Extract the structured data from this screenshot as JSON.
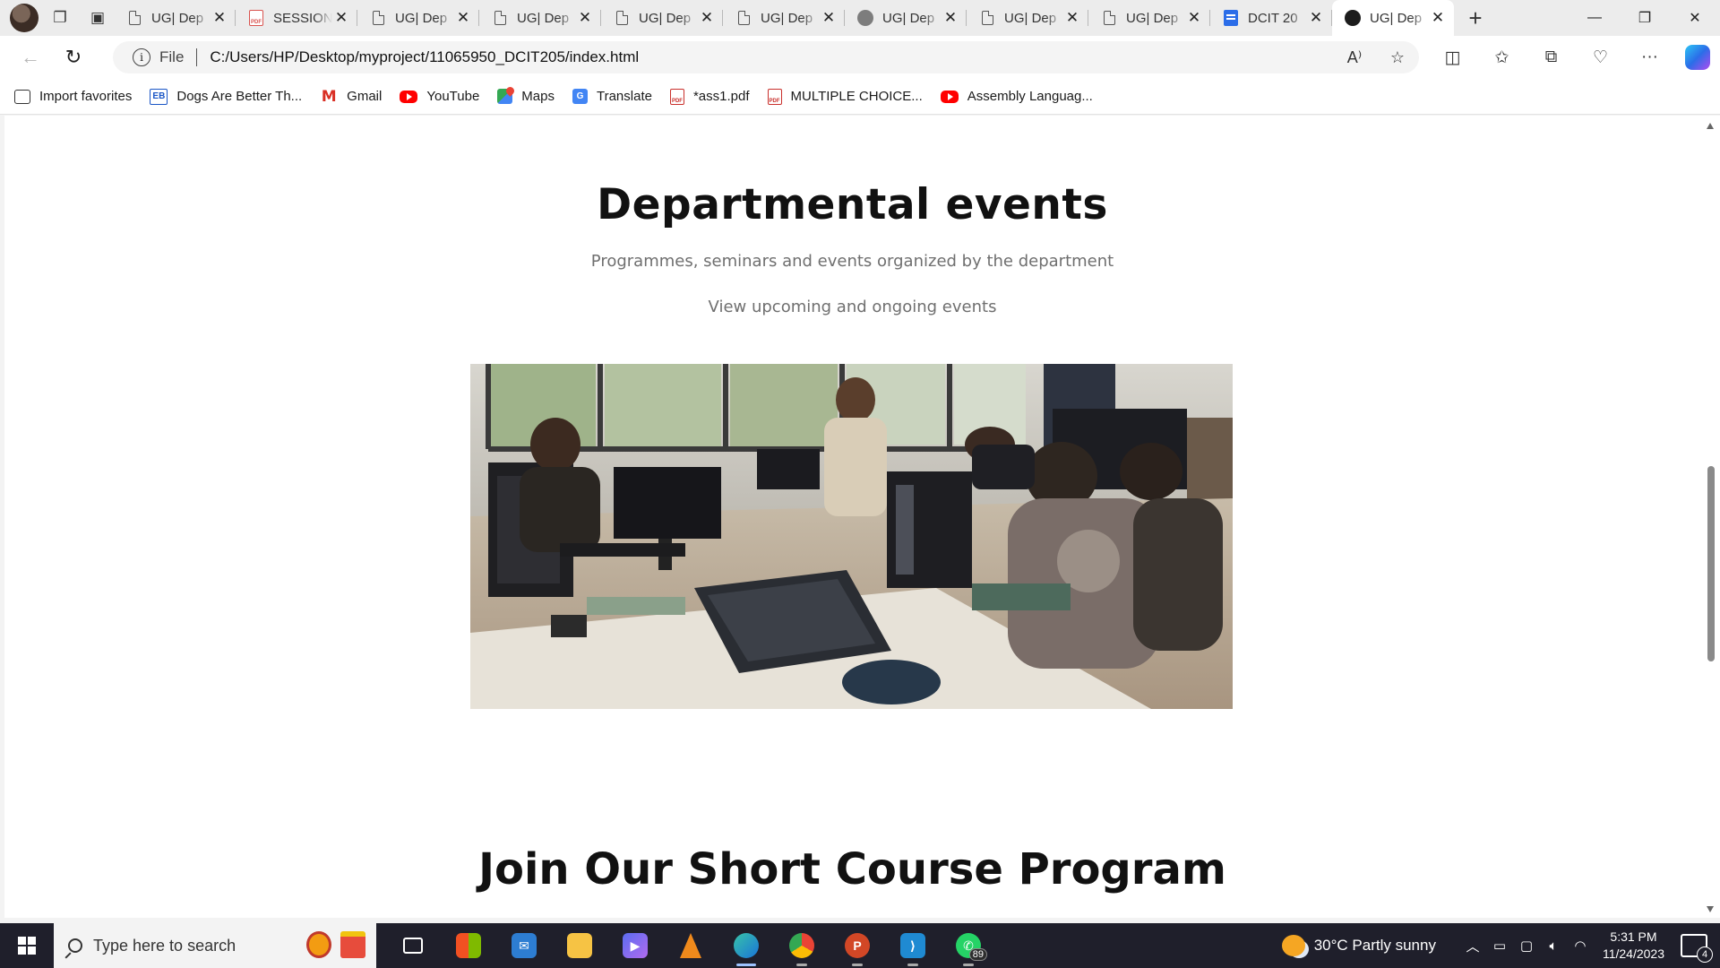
{
  "browser": {
    "tabs": [
      {
        "title": "UG| Dep",
        "icon": "page-icon",
        "active": false
      },
      {
        "title": "SESSION",
        "icon": "pdf-icon",
        "active": false
      },
      {
        "title": "UG| Dep",
        "icon": "page-icon",
        "active": false
      },
      {
        "title": "UG| Dep",
        "icon": "page-icon",
        "active": false
      },
      {
        "title": "UG| Dep",
        "icon": "page-icon",
        "active": false
      },
      {
        "title": "UG| Dep",
        "icon": "page-icon",
        "active": false
      },
      {
        "title": "UG| Dep",
        "icon": "logo-grey-icon",
        "active": false
      },
      {
        "title": "UG| Dep",
        "icon": "page-icon",
        "active": false
      },
      {
        "title": "UG| Dep",
        "icon": "page-icon",
        "active": false
      },
      {
        "title": "DCIT 20",
        "icon": "doc-icon",
        "active": false
      },
      {
        "title": "UG| Dep",
        "icon": "logo-icon",
        "active": true
      }
    ],
    "address": {
      "scheme_label": "File",
      "url": "C:/Users/HP/Desktop/myproject/11065950_DCIT205/index.html"
    },
    "favorites": [
      {
        "label": "Import favorites",
        "icon": "import-icon"
      },
      {
        "label": "Dogs Are Better Th...",
        "icon": "eb-icon",
        "icon_text": "EB"
      },
      {
        "label": "Gmail",
        "icon": "gmail-icon",
        "icon_text": "M"
      },
      {
        "label": "YouTube",
        "icon": "youtube-icon"
      },
      {
        "label": "Maps",
        "icon": "maps-icon"
      },
      {
        "label": "Translate",
        "icon": "translate-icon",
        "icon_text": "G"
      },
      {
        "label": "*ass1.pdf",
        "icon": "pdf-icon",
        "icon_text": "PDF"
      },
      {
        "label": "MULTIPLE CHOICE...",
        "icon": "pdf-icon",
        "icon_text": "PDF"
      },
      {
        "label": "Assembly Languag...",
        "icon": "youtube-icon"
      }
    ]
  },
  "page": {
    "events": {
      "heading": "Departmental events",
      "subtitle": "Programmes, seminars and events organized by the department",
      "cta_text": "View upcoming and ongoing events"
    },
    "course": {
      "heading": "Join Our Short Course Program"
    }
  },
  "taskbar": {
    "search_placeholder": "Type here to search",
    "apps": [
      {
        "name": "task-view",
        "active": false
      },
      {
        "name": "microsoft-store",
        "active": false
      },
      {
        "name": "mail",
        "active": false
      },
      {
        "name": "file-explorer",
        "active": false
      },
      {
        "name": "clipchamp",
        "active": false
      },
      {
        "name": "vlc",
        "active": false
      },
      {
        "name": "edge",
        "active": true
      },
      {
        "name": "chrome",
        "active": false
      },
      {
        "name": "powerpoint",
        "active": false
      },
      {
        "name": "vscode",
        "active": false
      },
      {
        "name": "whatsapp",
        "active": false,
        "badge": "89"
      }
    ],
    "weather": {
      "temp": "30°C",
      "condition": "Partly sunny"
    },
    "clock": {
      "time": "5:31 PM",
      "date": "11/24/2023"
    },
    "notifications": "4"
  },
  "colors": {
    "accent": "#2b6de8",
    "subtitle_gray": "#6f6f6f",
    "heading": "#111111"
  }
}
